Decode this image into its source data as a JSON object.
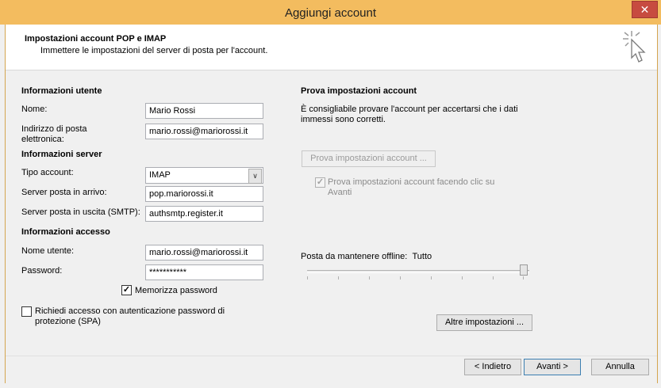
{
  "window": {
    "title": "Aggiungi account",
    "close_symbol": "✕"
  },
  "header": {
    "title": "Impostazioni account POP e IMAP",
    "subtitle": "Immettere le impostazioni del server di posta per l'account."
  },
  "user_info": {
    "heading": "Informazioni utente",
    "name_label": "Nome:",
    "name_value": "Mario Rossi",
    "email_label_line1": "Indirizzo di posta",
    "email_label_line2": "elettronica:",
    "email_value": "mario.rossi@mariorossi.it"
  },
  "server_info": {
    "heading": "Informazioni server",
    "account_type_label": "Tipo account:",
    "account_type_value": "IMAP",
    "incoming_label": "Server posta in arrivo:",
    "incoming_value": "pop.mariorossi.it",
    "outgoing_label": "Server posta in uscita (SMTP):",
    "outgoing_value": "authsmtp.register.it"
  },
  "access_info": {
    "heading": "Informazioni accesso",
    "username_label": "Nome utente:",
    "username_value": "mario.rossi@mariorossi.it",
    "password_label": "Password:",
    "password_value": "***********",
    "remember_label": "Memorizza password",
    "remember_checked": true,
    "spa_label_line1": "Richiedi accesso con autenticazione password di",
    "spa_label_line2": "protezione (SPA)",
    "spa_checked": false
  },
  "test": {
    "heading": "Prova impostazioni account",
    "desc_line1": "È consigliabile provare l'account per accertarsi che i dati",
    "desc_line2": "immessi sono corretti.",
    "test_button": "Prova impostazioni account ...",
    "auto_test_line1": "Prova impostazioni account facendo clic su",
    "auto_test_line2": "Avanti",
    "auto_test_checked": true
  },
  "offline": {
    "label": "Posta da mantenere offline:",
    "value": "Tutto",
    "slider_level": 1.0
  },
  "buttons": {
    "more_settings": "Altre impostazioni ...",
    "back": "< Indietro",
    "next": "Avanti >",
    "cancel": "Annulla"
  },
  "icons": {
    "wizard": "cursor-click-icon",
    "dropdown": "chevron-down-icon",
    "check": "checkmark-icon"
  },
  "colors": {
    "titlebar": "#f3bc5f",
    "close": "#c74b40",
    "focus_border": "#3c7fb1"
  }
}
